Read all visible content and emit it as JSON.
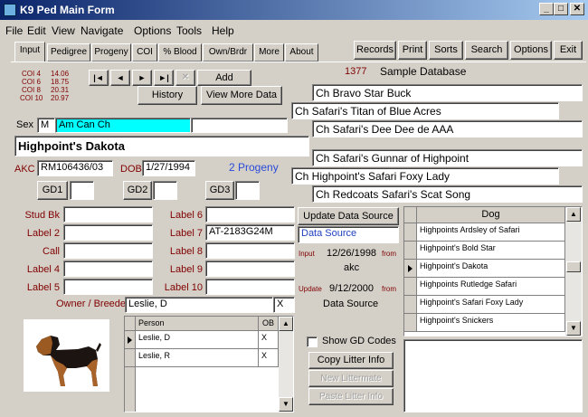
{
  "window": {
    "title": "K9 Ped Main Form",
    "min": "_",
    "max": "□",
    "close": "✕"
  },
  "menu": [
    "File",
    "Edit",
    "View",
    "Navigate",
    "Options",
    "Tools",
    "Help"
  ],
  "tabs": [
    "Input",
    "Pedigree",
    "Progeny",
    "COI",
    "% Blood",
    "Own/Brdr",
    "More",
    "About"
  ],
  "toolbar": [
    "Records",
    "Print",
    "Sorts",
    "Search",
    "Options",
    "Exit"
  ],
  "coi": [
    {
      "label": "COI 4",
      "value": "14.06"
    },
    {
      "label": "COI 6",
      "value": "18.75"
    },
    {
      "label": "COI 8",
      "value": "20.31"
    },
    {
      "label": "COI 10",
      "value": "20.97"
    }
  ],
  "nav": {
    "first": "|◄",
    "prev": "◄",
    "next": "►",
    "last": "►|",
    "delete": "✕",
    "add": "Add",
    "history": "History",
    "view_more": "View More Data"
  },
  "record": {
    "number": "1377",
    "database": "Sample Database"
  },
  "dog": {
    "sex_label": "Sex",
    "sex": "M",
    "title": "Am Can Ch",
    "title_after": "",
    "name": "Highpoint's Dakota",
    "akc_label": "AKC",
    "akc": "RM106436/03",
    "dob_label": "DOB",
    "dob": "1/27/1994",
    "progeny": "2 Progeny",
    "gd1": "GD1",
    "gd2": "GD2",
    "gd3": "GD3"
  },
  "pedigree": [
    "Ch Bravo Star Buck",
    "Ch Safari's Titan of Blue Acres",
    "Ch Safari's Dee Dee de AAA",
    "Ch Safari's Gunnar of Highpoint",
    "Ch Highpoint's Safari Foxy Lady",
    "Ch Redcoats Safari's Scat Song"
  ],
  "labels_left": [
    "Stud Bk",
    "Label 2",
    "Call",
    "Label 4",
    "Label 5"
  ],
  "labels_right": [
    {
      "label": "Label 6",
      "value": ""
    },
    {
      "label": "Label 7",
      "value": "AT-2183G24M"
    },
    {
      "label": "Label 8",
      "value": ""
    },
    {
      "label": "Label 9",
      "value": ""
    },
    {
      "label": "Label 10",
      "value": ""
    }
  ],
  "owner": {
    "label": "Owner / Breeder",
    "value": "Leslie, D",
    "flag": "X"
  },
  "owner_grid": {
    "headers": [
      "Person",
      "OB"
    ],
    "rows": [
      [
        "Leslie, D",
        "X"
      ],
      [
        "Leslie, R",
        "X"
      ]
    ]
  },
  "data_source": {
    "button": "Update Data Source",
    "field": "Data Source",
    "input_label": "Input",
    "input_date": "12/26/1998",
    "from1": "from",
    "input_from": "akc",
    "update_label": "Update",
    "update_date": "9/12/2000",
    "from2": "from",
    "update_from": "Data Source"
  },
  "dog_grid": {
    "header": "Dog",
    "rows": [
      "Highpoints Ardsley of Safari",
      "Highpoint's Bold Star",
      "Highpoint's Dakota",
      "Highpoints Rutledge Safari",
      "Highpoint's Safari Foxy Lady",
      "Highpoint's Snickers"
    ]
  },
  "gd_codes": "Show GD Codes",
  "litter": {
    "copy": "Copy Litter Info",
    "new": "New Littermate",
    "paste": "Paste Litter Info"
  }
}
